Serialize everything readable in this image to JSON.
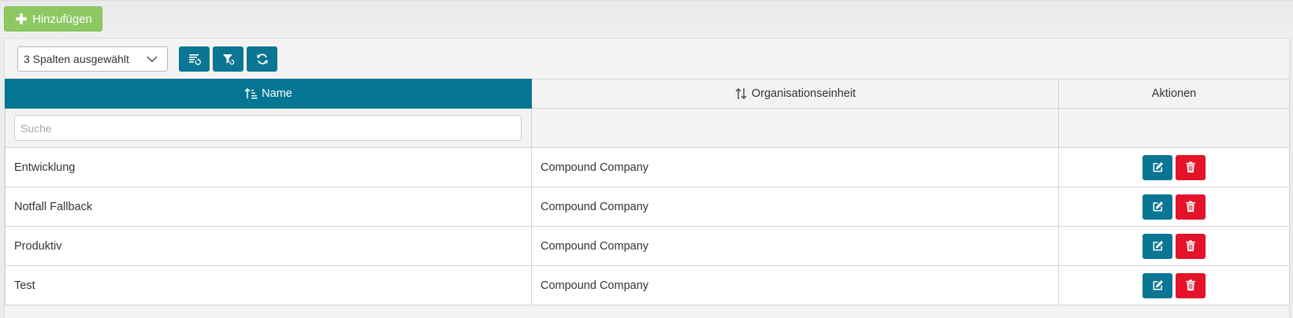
{
  "toolbar": {
    "add_label": "Hinzufügen"
  },
  "columns_select": {
    "value": "3 Spalten ausgewählt"
  },
  "table": {
    "headers": {
      "name": "Name",
      "org": "Organisationseinheit",
      "actions": "Aktionen"
    },
    "search_placeholder": "Suche",
    "rows": [
      {
        "name": "Entwicklung",
        "org": "Compound Company"
      },
      {
        "name": "Notfall Fallback",
        "org": "Compound Company"
      },
      {
        "name": "Produktiv",
        "org": "Compound Company"
      },
      {
        "name": "Test",
        "org": "Compound Company"
      }
    ]
  },
  "icons": {
    "add": "plus-icon",
    "column_chooser": "column-list-icon",
    "reset_filter": "filter-reset-icon",
    "refresh": "refresh-icon",
    "sort_asc": "sort-ascending-icon",
    "sort_both": "sort-arrows-icon",
    "edit": "edit-icon",
    "delete": "trash-icon",
    "dropdown": "chevron-down-icon"
  },
  "colors": {
    "primary": "#0a7693",
    "success": "#8cc963",
    "danger": "#e3142a"
  }
}
